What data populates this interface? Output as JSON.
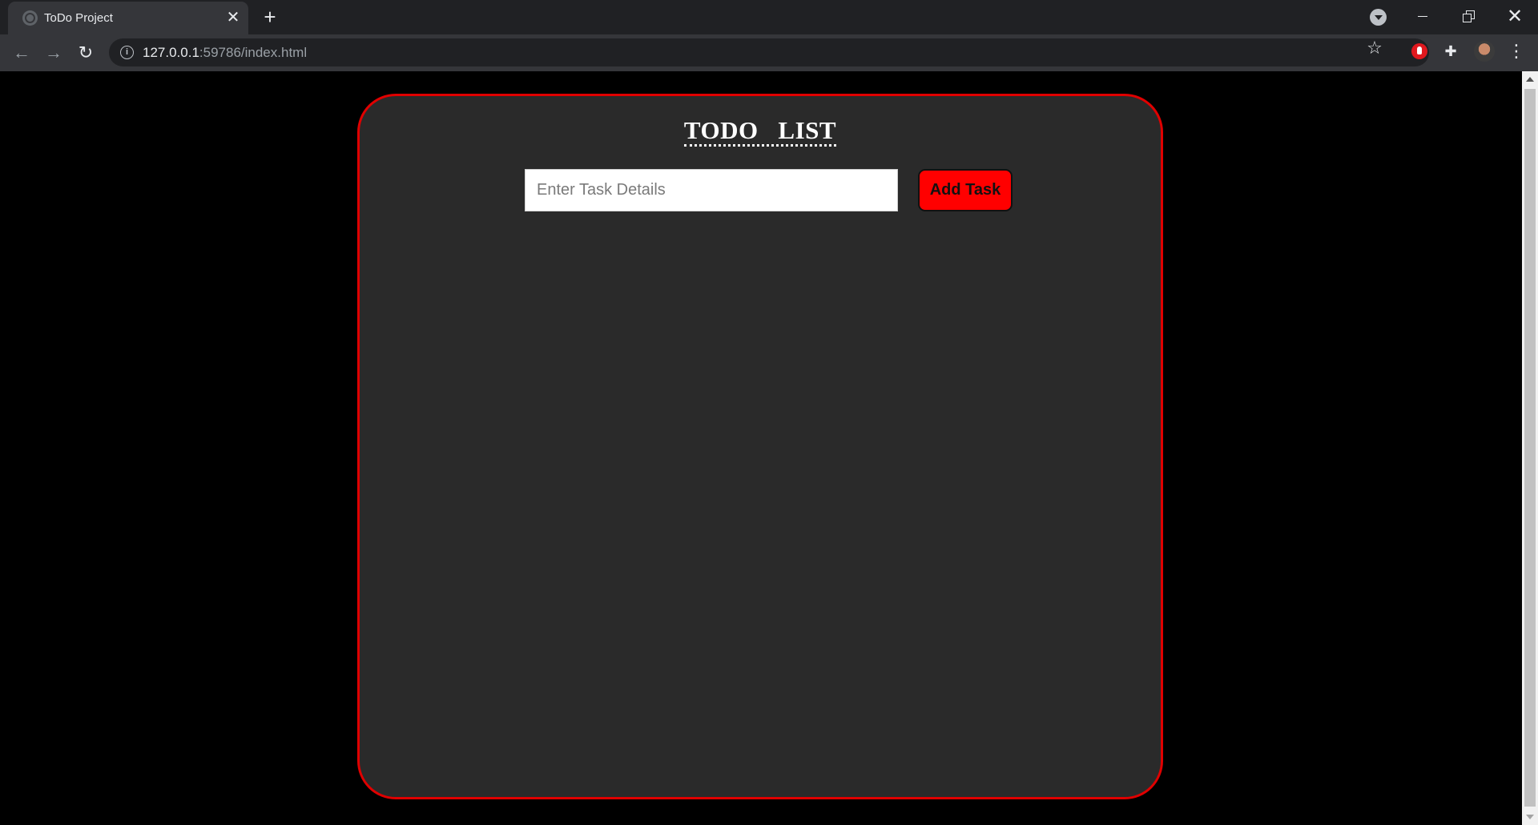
{
  "browser": {
    "tab_title": "ToDo Project",
    "tab_close_glyph": "✕",
    "new_tab_glyph": "+",
    "url_host": "127.0.0.1",
    "url_rest": ":59786/index.html"
  },
  "todo": {
    "title": "TODO   LIST",
    "input_placeholder": "Enter Task Details",
    "add_button_label": "Add Task"
  },
  "colors": {
    "card_border": "#e00000",
    "card_background": "#2a2a2a",
    "button_background": "#ff0000",
    "page_background": "#000000"
  }
}
